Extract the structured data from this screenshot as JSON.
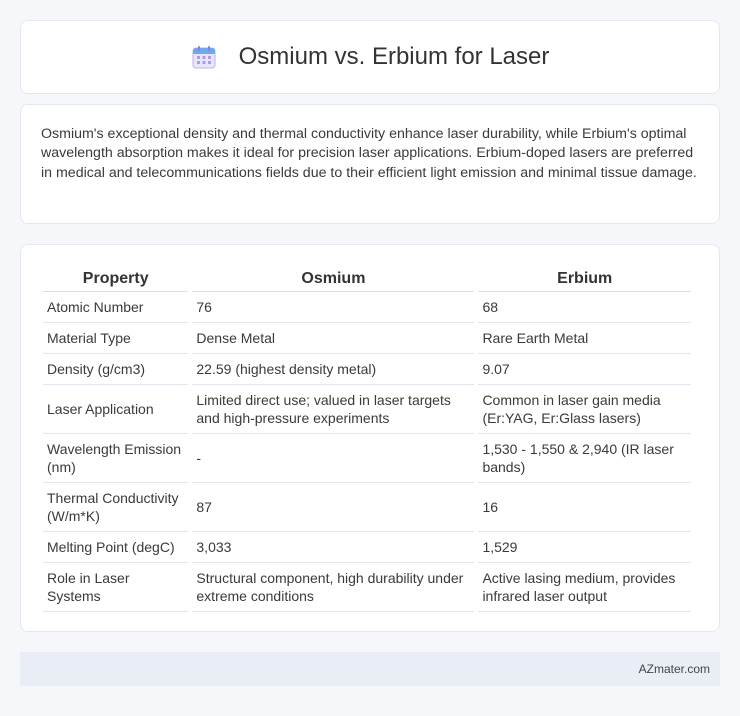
{
  "header": {
    "title": "Osmium vs. Erbium for Laser",
    "icon": "calendar-icon"
  },
  "summary": {
    "text": "Osmium's exceptional density and thermal conductivity enhance laser durability, while Erbium's optimal wavelength absorption makes it ideal for precision laser applications. Erbium-doped lasers are preferred in medical and telecommunications fields due to their efficient light emission and minimal tissue damage."
  },
  "table": {
    "headers": [
      "Property",
      "Osmium",
      "Erbium"
    ],
    "rows": [
      [
        "Atomic Number",
        "76",
        "68"
      ],
      [
        "Material Type",
        "Dense Metal",
        "Rare Earth Metal"
      ],
      [
        "Density (g/cm3)",
        "22.59 (highest density metal)",
        "9.07"
      ],
      [
        "Laser Application",
        "Limited direct use; valued in laser targets and high-pressure experiments",
        "Common in laser gain media (Er:YAG, Er:Glass lasers)"
      ],
      [
        "Wavelength Emission (nm)",
        "-",
        "1,530 - 1,550 & 2,940 (IR laser bands)"
      ],
      [
        "Thermal Conductivity (W/m*K)",
        "87",
        "16"
      ],
      [
        "Melting Point (degC)",
        "3,033",
        "1,529"
      ],
      [
        "Role in Laser Systems",
        "Structural component, high durability under extreme conditions",
        "Active lasing medium, provides infrared laser output"
      ]
    ]
  },
  "footer": {
    "text": "AZmater.com"
  },
  "colors": {
    "background": "#f6f7fb",
    "card": "#ffffff",
    "footer_bg": "#e9edf6",
    "icon_accent": "#8b7fd6"
  }
}
